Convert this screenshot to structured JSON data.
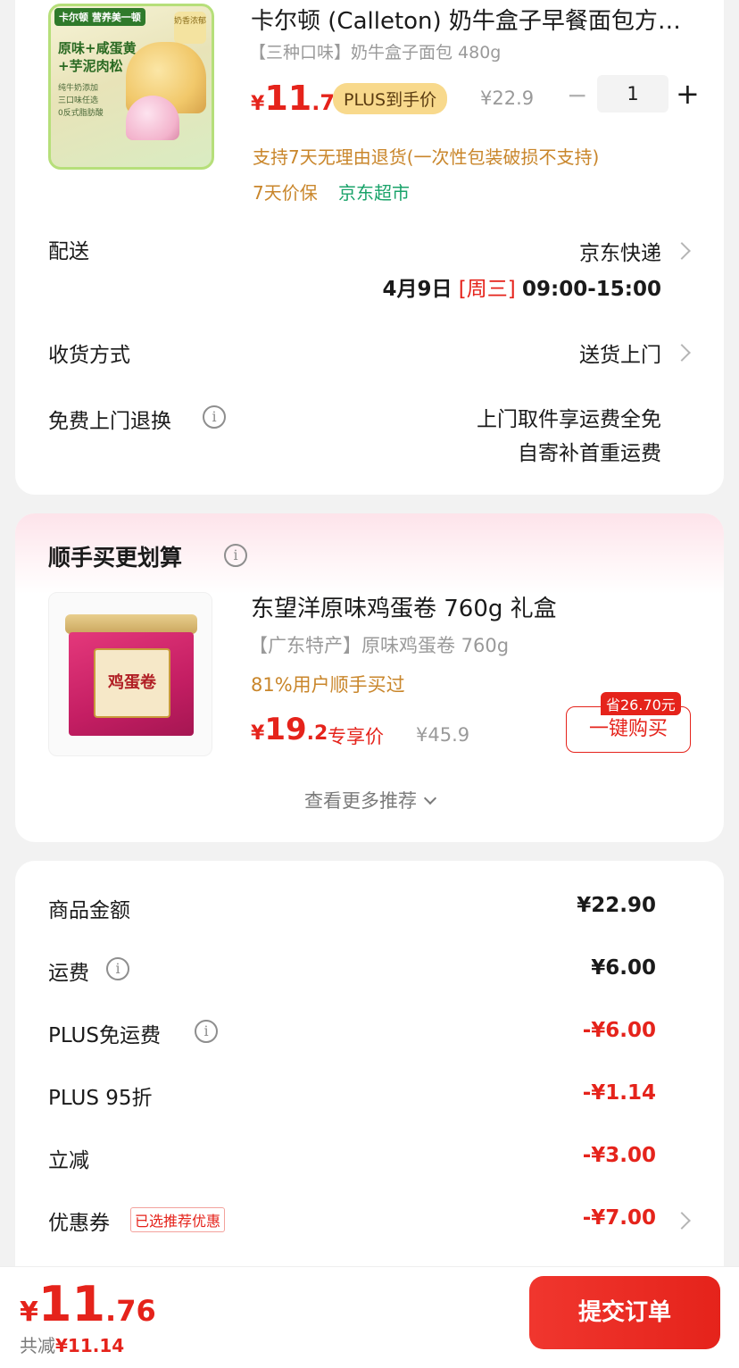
{
  "product1": {
    "title": "卡尔顿 (Calleton) 奶牛盒子早餐面包方…",
    "spec": "【三种口味】奶牛盒子面包 480g",
    "price_currency": "¥",
    "price_int": "11",
    "price_dec": ".76",
    "plus_badge": "PLUS到手价",
    "orig_price": "¥22.9",
    "qty_minus": "−",
    "quantity": "1",
    "qty_plus": "+",
    "return_policy": "支持7天无理由退货(一次性包装破损不支持)",
    "price_protect": "7天价保",
    "supermarket": "京东超市",
    "image_text": {
      "brand_tag": "卡尔顿 营养美一顿",
      "line1": "原味+咸蛋黄",
      "line2": "+芋泥肉松",
      "small1": "纯牛奶添加",
      "small2": "三口味任选",
      "small3": "0反式脂肪酸",
      "badge": "奶香浓郁"
    }
  },
  "delivery": {
    "label": "配送",
    "carrier": "京东快递",
    "date": "4月9日",
    "weekday": "[周三]",
    "time": "09:00-15:00"
  },
  "receive": {
    "label": "收货方式",
    "value": "送货上门"
  },
  "free_return": {
    "label": "免费上门退换",
    "info_icon": "i",
    "line1": "上门取件享运费全免",
    "line2": "自寄补首重运费"
  },
  "addon": {
    "title": "顺手买更划算",
    "info_icon": "i",
    "tin_label": "鸡蛋卷",
    "name": "东望洋原味鸡蛋卷 760g 礼盒",
    "spec": "【广东特产】原味鸡蛋卷 760g",
    "stat": "81%用户顺手买过",
    "price_currency": "¥",
    "price_int": "19",
    "price_dec": ".2",
    "exclusive": "专享价",
    "orig_price": "¥45.9",
    "save_tag": "省26.70元",
    "buy_button": "一键购买",
    "more": "查看更多推荐"
  },
  "fees": {
    "items": [
      {
        "label": "商品金额",
        "value": "¥22.90"
      },
      {
        "label": "运费",
        "value": "¥6.00"
      },
      {
        "label": "PLUS免运费",
        "value": "-¥6.00"
      },
      {
        "label": "PLUS 95折",
        "value": "-¥1.14"
      },
      {
        "label": "立减",
        "value": "-¥3.00"
      },
      {
        "label": "优惠券",
        "value": "-¥7.00"
      }
    ],
    "coupon_tag": "已选推荐优惠",
    "info_icon": "i"
  },
  "bottom": {
    "price_currency": "¥",
    "price_int": "11",
    "price_dec": ".76",
    "save_label": "共减",
    "save_amount": "¥11.14",
    "submit": "提交订单"
  },
  "colors": {
    "accent_red": "#e5231b",
    "gold_text": "#c9862b",
    "green_text": "#1aa36a",
    "plus_badge_bg": "#f8d98c"
  },
  "icons": [
    "info-icon",
    "chevron-right-icon",
    "chevron-down-icon",
    "minus-icon",
    "plus-icon"
  ]
}
